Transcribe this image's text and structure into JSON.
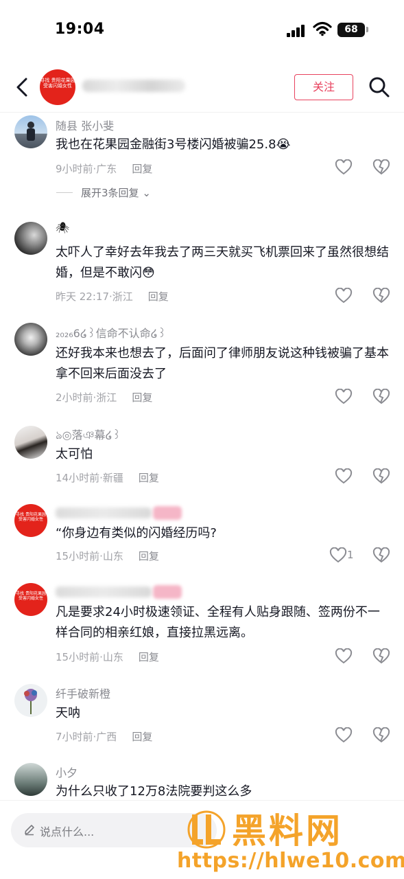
{
  "status_bar": {
    "time": "19:04",
    "battery": "68"
  },
  "header": {
    "avatar_text": "寻找 贵阳花果园 受害闪婚女性",
    "follow_label": "关注"
  },
  "comments": [
    {
      "name": "随县 张小斐",
      "text": "我也在花果园金融街3号楼闪婚被骗25.8😭",
      "time": "9小时前·广东",
      "reply": "回复",
      "expand": "展开3条回复"
    },
    {
      "name": "🕷",
      "text": "太吓人了幸好去年我去了两三天就买飞机票回来了虽然很想结婚，但是不敢闪😳",
      "time": "昨天 22:17·浙江",
      "reply": "回复"
    },
    {
      "name": "₂₀₂₆6໒꒱信命不认命໒꒱",
      "text": "还好我本来也想去了，后面问了律师朋友说这种钱被骗了基本拿不回来后面没去了",
      "time": "2小时前·浙江",
      "reply": "回复"
    },
    {
      "name": "ঌ◎落ঞ幕໒꒱",
      "text": "太可怕",
      "time": "14小时前·新疆",
      "reply": "回复"
    },
    {
      "avatar_text": "寻找 贵阳花果园 受害闪婚女性",
      "text": "“你身边有类似的闪婚经历吗?",
      "time": "15小时前·山东",
      "reply": "回复",
      "like_count": "1"
    },
    {
      "avatar_text": "寻找 贵阳花果园 受害闪婚女性",
      "text": "凡是要求24小时极速领证、全程有人贴身跟随、签两份不一样合同的相亲红娘，直接拉黑远离。",
      "time": "15小时前·山东",
      "reply": "回复"
    },
    {
      "name": "纤手破新橙",
      "text": "天呐",
      "time": "7小时前·广西",
      "reply": "回复"
    },
    {
      "name": "小夕",
      "text": "为什么只收了12万8法院要判这么多"
    }
  ],
  "bottom": {
    "input_placeholder": "说点什么...",
    "watermark_title": "黑料网",
    "watermark_url": "https://hlwe10.com"
  },
  "icons": {
    "back": "chevron-left-icon",
    "search": "search-icon",
    "like": "heart-outline-icon",
    "dislike": "broken-heart-icon"
  },
  "colors": {
    "accent": "#e8415d",
    "brand_red": "#e3231b",
    "watermark": "#f4a32a"
  }
}
